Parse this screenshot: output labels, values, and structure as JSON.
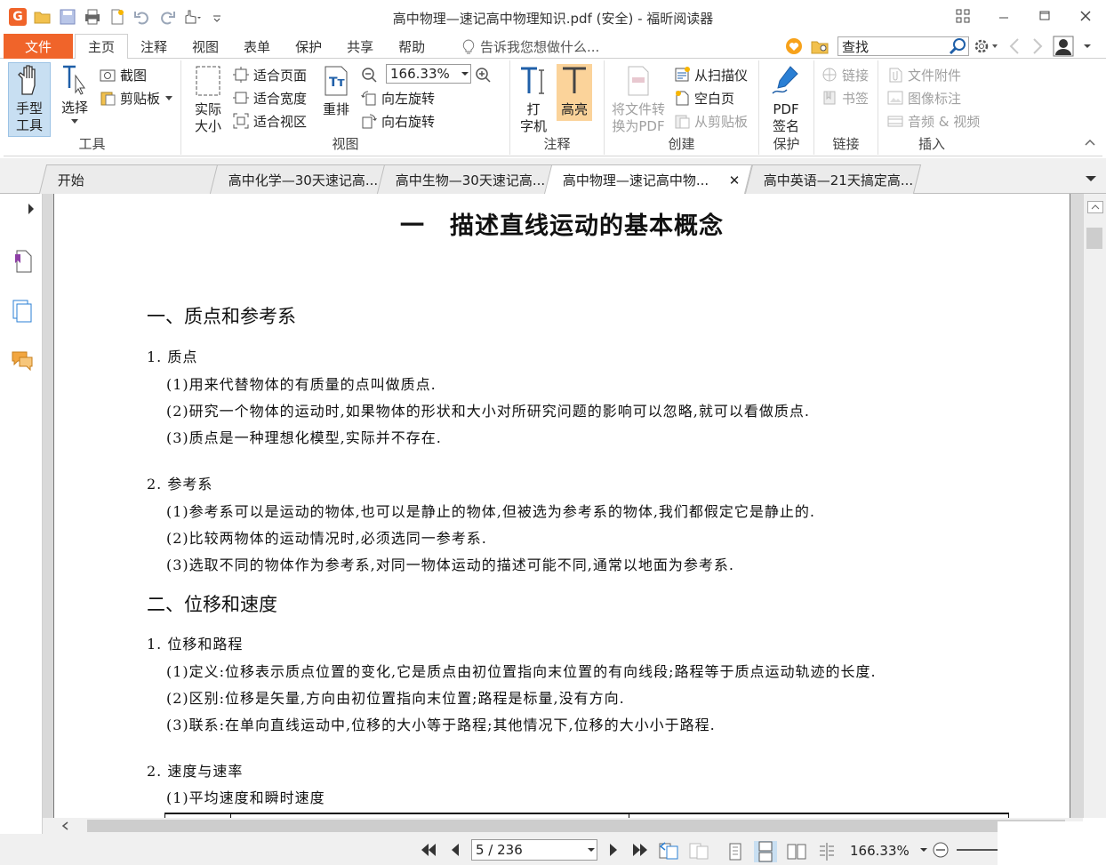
{
  "window": {
    "title": "高中物理—速记高中物理知识.pdf (安全) - 福昕阅读器"
  },
  "menu": {
    "file": "文件",
    "tabs": [
      "主页",
      "注释",
      "视图",
      "表单",
      "保护",
      "共享",
      "帮助"
    ],
    "tell_me": "告诉我您想做什么...",
    "search_placeholder": "查找"
  },
  "ribbon": {
    "tools": {
      "label": "工具",
      "hand": "手型工具",
      "hand_l1": "手型",
      "hand_l2": "工具",
      "select": "选择",
      "screenshot": "截图",
      "clipboard": "剪贴板"
    },
    "view": {
      "label": "视图",
      "actual_l1": "实际",
      "actual_l2": "大小",
      "fit_page": "适合页面",
      "fit_width": "适合宽度",
      "fit_visible": "适合视区",
      "reflow": "重排",
      "zoom_value": "166.33%",
      "rotate_left": "向左旋转",
      "rotate_right": "向右旋转"
    },
    "comment": {
      "label": "注释",
      "typewriter_l1": "打",
      "typewriter_l2": "字机",
      "highlight": "高亮"
    },
    "create": {
      "label": "创建",
      "convert_l1": "将文件转",
      "convert_l2": "换为PDF",
      "from_scanner": "从扫描仪",
      "blank_page": "空白页",
      "from_clipboard": "从剪贴板"
    },
    "protect": {
      "label": "保护",
      "sign_l1": "PDF",
      "sign_l2": "签名"
    },
    "links": {
      "label": "链接",
      "link": "链接",
      "bookmark": "书签"
    },
    "insert": {
      "label": "插入",
      "attachment": "文件附件",
      "image_annot": "图像标注",
      "audio_video": "音频 & 视频"
    }
  },
  "doc_tabs": [
    "开始",
    "高中化学—30天速记高...",
    "高中生物—30天速记高...",
    "高中物理—速记高中物...",
    "高中英语—21天搞定高..."
  ],
  "document": {
    "chapter": "一　描述直线运动的基本概念",
    "s1": "一、质点和参考系",
    "s1_1": "1. 质点",
    "s1_1_p": [
      "(1)用来代替物体的有质量的点叫做质点.",
      "(2)研究一个物体的运动时,如果物体的形状和大小对所研究问题的影响可以忽略,就可以看做质点.",
      "(3)质点是一种理想化模型,实际并不存在."
    ],
    "s1_2": "2. 参考系",
    "s1_2_p": [
      "(1)参考系可以是运动的物体,也可以是静止的物体,但被选为参考系的物体,我们都假定它是静止的.",
      "(2)比较两物体的运动情况时,必须选同一参考系.",
      "(3)选取不同的物体作为参考系,对同一物体运动的描述可能不同,通常以地面为参考系."
    ],
    "s2": "二、位移和速度",
    "s2_1": "1. 位移和路程",
    "s2_1_p": [
      "(1)定义:位移表示质点位置的变化,它是质点由初位置指向末位置的有向线段;路程等于质点运动轨迹的长度.",
      "(2)区别:位移是矢量,方向由初位置指向末位置;路程是标量,没有方向.",
      "(3)联系:在单向直线运动中,位移的大小等于路程;其他情况下,位移的大小小于路程."
    ],
    "s2_2": "2. 速度与速率",
    "s2_2_p": [
      "(1)平均速度和瞬时速度"
    ]
  },
  "status": {
    "page": "5 / 236",
    "zoom": "166.33%"
  },
  "colors": {
    "accent": "#f0642a",
    "selected": "#c8dff2",
    "highlight": "#fbd39a"
  }
}
